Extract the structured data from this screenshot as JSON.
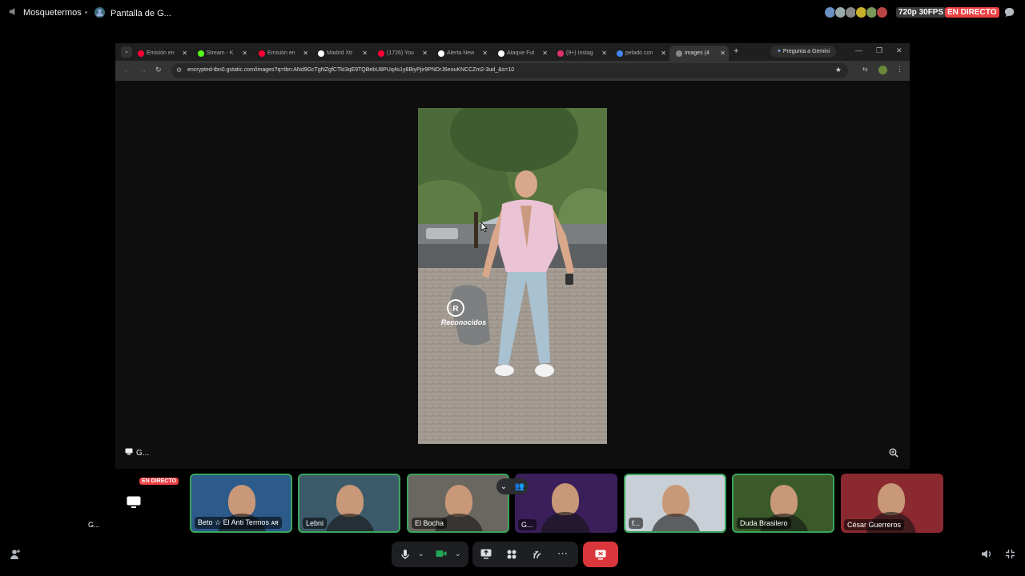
{
  "topbar": {
    "channel": "Mosquetermos",
    "screen": "Pantalla de G...",
    "quality": "720p 30FPS",
    "live": "EN DIRECTO"
  },
  "browser": {
    "tabs": [
      {
        "label": "Emisión en",
        "icon_color": "#ff0033"
      },
      {
        "label": "Stream - K",
        "icon_color": "#53fc18"
      },
      {
        "label": "Emisión en",
        "icon_color": "#ff0033"
      },
      {
        "label": "Madrid Xtr",
        "icon_color": "#ffffff"
      },
      {
        "label": "(1726) You",
        "icon_color": "#ff0033"
      },
      {
        "label": "Alerta New",
        "icon_color": "#ffffff"
      },
      {
        "label": "Ataque Fut",
        "icon_color": "#ffffff"
      },
      {
        "label": "(9+) Instag",
        "icon_color": "#e1306c"
      },
      {
        "label": "pelado con",
        "icon_color": "#4285f4"
      },
      {
        "label": "images (4",
        "icon_color": "#888888"
      }
    ],
    "new_tab": "+",
    "gemini_label": "Pregunta a Gemini",
    "url": "encrypted-tbn0.gstatic.com/images?q=tbn:ANd9GcTgNZgfCTkI3qE9TQBebU8PUq4s1y8BiyPjir9PNDrJ6eouKNCCZm2-3ud_&s=10",
    "image_watermark": "Reconocidos",
    "share_label": "G..."
  },
  "participants": [
    {
      "name": "G...",
      "live": "EN DIRECTO",
      "kind": "screen"
    },
    {
      "name": "Beto ☆ El Anti Termos ᴀʀ",
      "kind": "cam"
    },
    {
      "name": "Lebni",
      "kind": "cam"
    },
    {
      "name": "El Bocha",
      "kind": "cam"
    },
    {
      "name": "G...",
      "kind": "cam"
    },
    {
      "name": "f...",
      "kind": "cam"
    },
    {
      "name": "Duda Brasilero",
      "kind": "cam"
    },
    {
      "name": "César Guerreros",
      "kind": "cam"
    }
  ],
  "icons": {
    "mic": "microphone-icon",
    "cam": "camera-icon",
    "share": "screen-share-icon",
    "activities": "activities-icon",
    "soundboard": "soundboard-icon",
    "more": "more-icon",
    "end": "disconnect-icon"
  },
  "colors": {
    "live_red": "#ed4245",
    "speaking_green": "#3ba55c",
    "end_red": "#da373c"
  }
}
